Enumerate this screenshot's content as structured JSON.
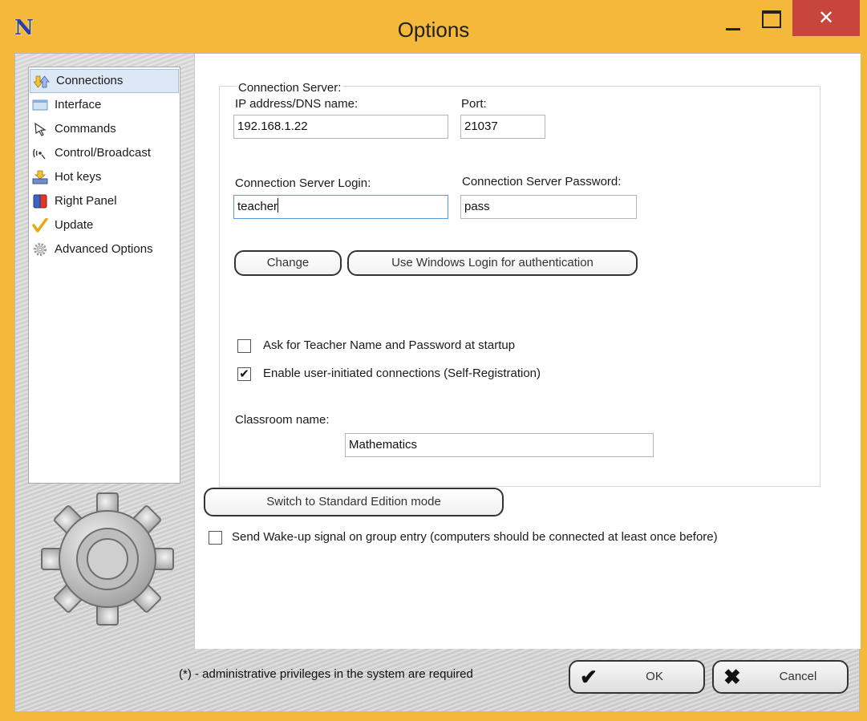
{
  "window": {
    "title": "Options",
    "close_glyph": "✕"
  },
  "sidebar": {
    "items": [
      {
        "label": "Connections",
        "icon": "connections-icon",
        "selected": true
      },
      {
        "label": "Interface",
        "icon": "interface-icon"
      },
      {
        "label": "Commands",
        "icon": "cursor-icon"
      },
      {
        "label": "Control/Broadcast",
        "icon": "broadcast-icon"
      },
      {
        "label": "Hot keys",
        "icon": "keyboard-icon"
      },
      {
        "label": "Right Panel",
        "icon": "panel-icon"
      },
      {
        "label": "Update",
        "icon": "checkmark-icon"
      },
      {
        "label": "Advanced Options",
        "icon": "gear-icon"
      }
    ]
  },
  "connection": {
    "group_label": "Connection Server:",
    "ip_label": "IP address/DNS name:",
    "ip_value": "192.168.1.22",
    "port_label": "Port:",
    "port_value": "21037",
    "login_label": "Connection Server Login:",
    "login_value": "teacher",
    "password_label": "Connection Server Password:",
    "password_value": "pass",
    "change_label": "Change",
    "windows_login_label": "Use Windows Login for authentication",
    "ask_label": "Ask for Teacher Name and Password at startup",
    "ask_checked": false,
    "self_reg_label": "Enable user-initiated connections (Self-Registration)",
    "self_reg_checked": true,
    "classroom_label": "Classroom name:",
    "classroom_value": "Mathematics"
  },
  "switch_label": "Switch to Standard Edition mode",
  "wakeup_label": "Send Wake-up signal on group entry (computers should be connected at least once before)",
  "wakeup_checked": false,
  "footer": {
    "note": "(*) - administrative privileges in the system are required",
    "ok_label": "OK",
    "cancel_label": "Cancel"
  },
  "colors": {
    "frame": "#f4b93a",
    "close_button": "#c7453c",
    "selection": "#dde8f6"
  }
}
